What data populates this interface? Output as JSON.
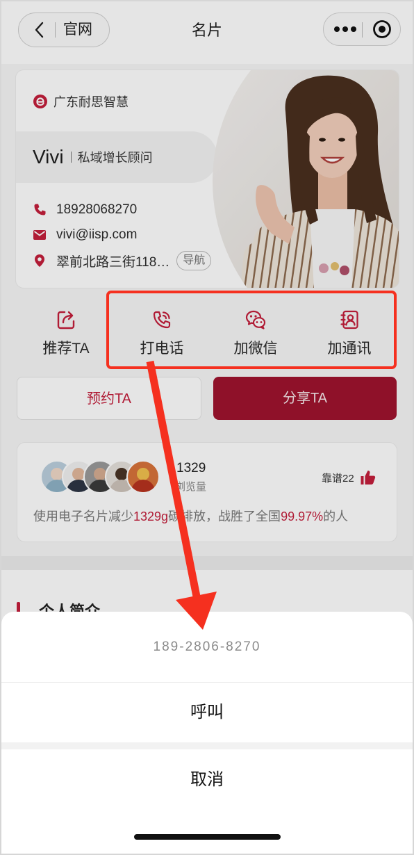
{
  "nav": {
    "back_label": "官网",
    "title": "名片",
    "back_icon": "chevron-left-icon",
    "more_icon": "more-dots-icon",
    "close_icon": "target-icon"
  },
  "card": {
    "company": "广东耐思智慧",
    "name": "Vivi",
    "title": "私域增长顾问",
    "phone": "18928068270",
    "email": "vivi@iisp.com",
    "address": "翠前北路三街118…",
    "nav_button": "导航"
  },
  "actions": [
    {
      "label": "推荐TA",
      "icon": "share-icon"
    },
    {
      "label": "打电话",
      "icon": "phone-call-icon"
    },
    {
      "label": "加微信",
      "icon": "wechat-icon"
    },
    {
      "label": "加通讯",
      "icon": "contact-book-icon"
    }
  ],
  "buttons": {
    "book": "预约TA",
    "share": "分享TA"
  },
  "stats": {
    "views": "1329",
    "views_label": "浏览量",
    "likes": "靠谱22",
    "summary": {
      "p1": "使用电子名片减少",
      "v1": "1329g",
      "p2": "碳排放，战胜了全国",
      "v2": "99.97%",
      "p3": "的人"
    }
  },
  "section": {
    "title": "个人简介"
  },
  "sheet": {
    "phone": "189-2806-8270",
    "call": "呼叫",
    "cancel": "取消"
  },
  "colors": {
    "brand": "#a0142e",
    "accent": "#c41f3b",
    "annotation": "#f5301f"
  }
}
